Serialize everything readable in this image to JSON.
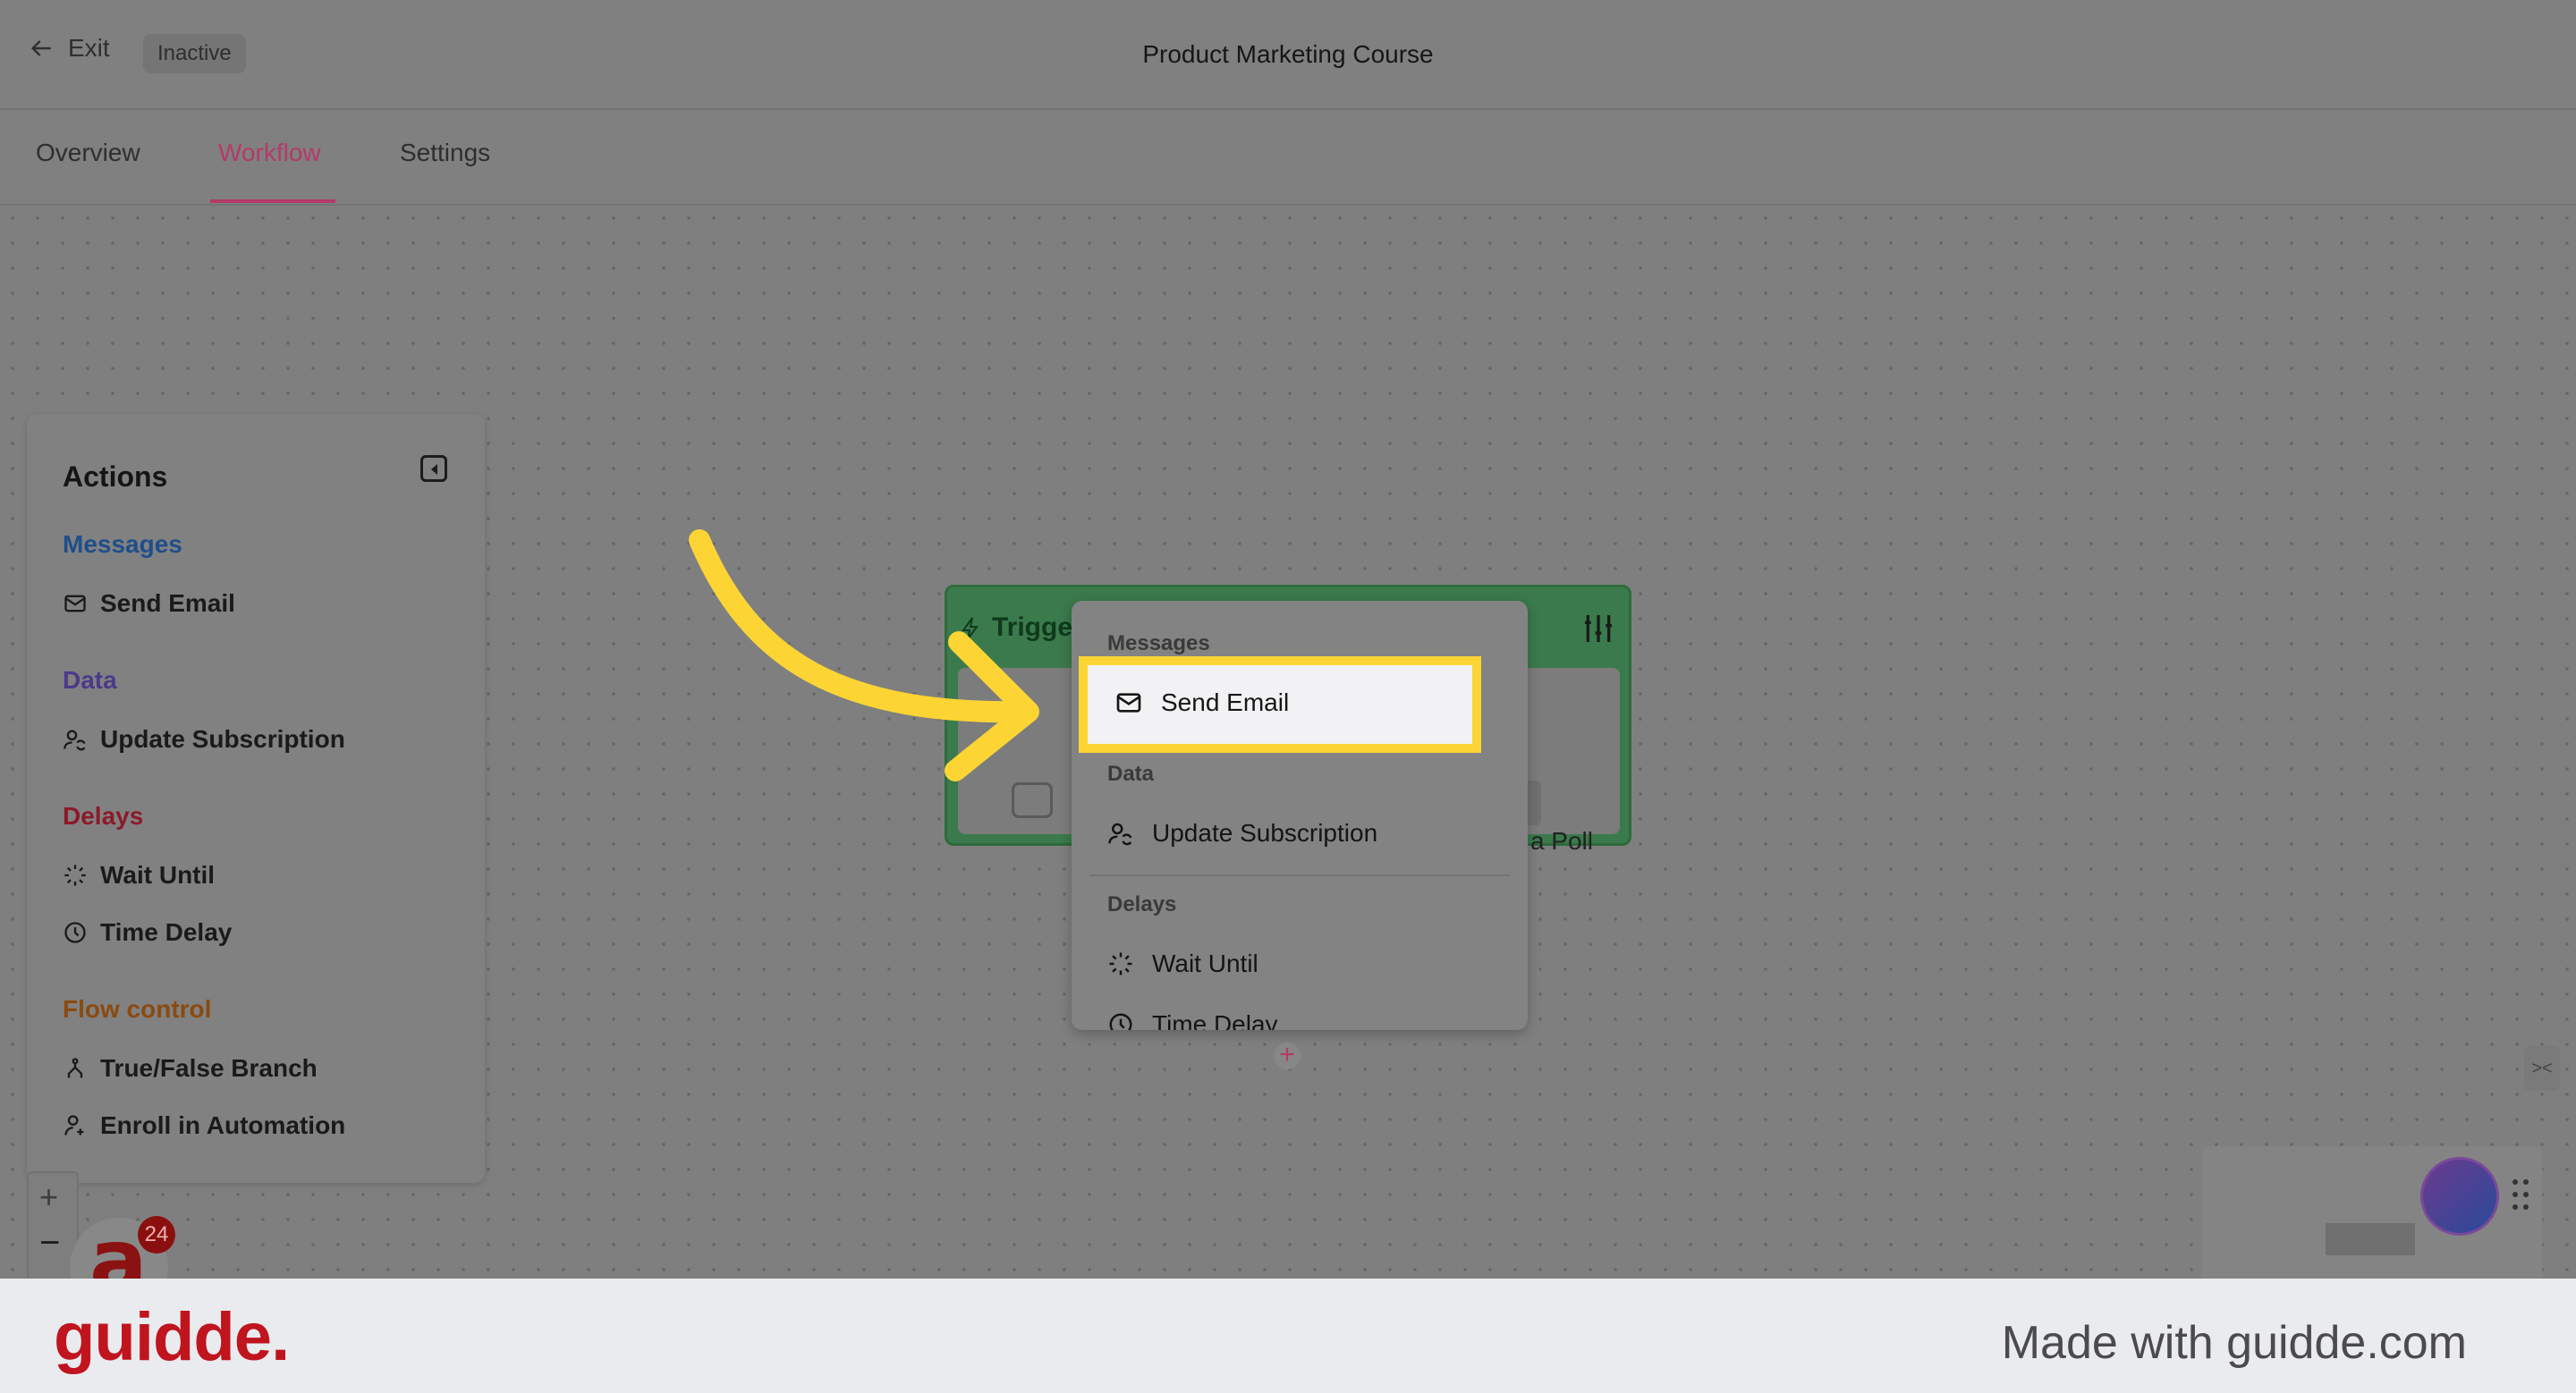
{
  "header": {
    "exit_label": "Exit",
    "status_badge": "Inactive",
    "title": "Product Marketing Course"
  },
  "tabs": [
    {
      "label": "Overview"
    },
    {
      "label": "Workflow"
    },
    {
      "label": "Settings"
    }
  ],
  "actions_panel": {
    "title": "Actions",
    "sections": [
      {
        "label": "Messages",
        "color": "#1f4e8a",
        "items": [
          "Send Email"
        ]
      },
      {
        "label": "Data",
        "color": "#4a3a8a",
        "items": [
          "Update Subscription"
        ]
      },
      {
        "label": "Delays",
        "color": "#8a1a2a",
        "items": [
          "Wait Until",
          "Time Delay"
        ]
      },
      {
        "label": "Flow control",
        "color": "#8a4a10",
        "items": [
          "True/False Branch",
          "Enroll in Automation"
        ]
      }
    ]
  },
  "trigger": {
    "label": "Trigge",
    "body_text": "a Poll"
  },
  "dropdown": {
    "sections": [
      {
        "label": "Messages",
        "items": [
          "Send Email"
        ]
      },
      {
        "label": "Data",
        "items": [
          "Update Subscription"
        ]
      },
      {
        "label": "Delays",
        "items": [
          "Wait Until",
          "Time Delay"
        ]
      }
    ]
  },
  "notifications": {
    "count": "24"
  },
  "zoom": {
    "plus": "+",
    "minus": "−"
  },
  "footer": {
    "brand": "guidde.",
    "tagline": "Made with guidde.com"
  },
  "colors": {
    "accent": "#b43a67",
    "highlight": "#fcd535",
    "trigger_green": "#3b7a4c",
    "brand_red": "#c0141e"
  }
}
